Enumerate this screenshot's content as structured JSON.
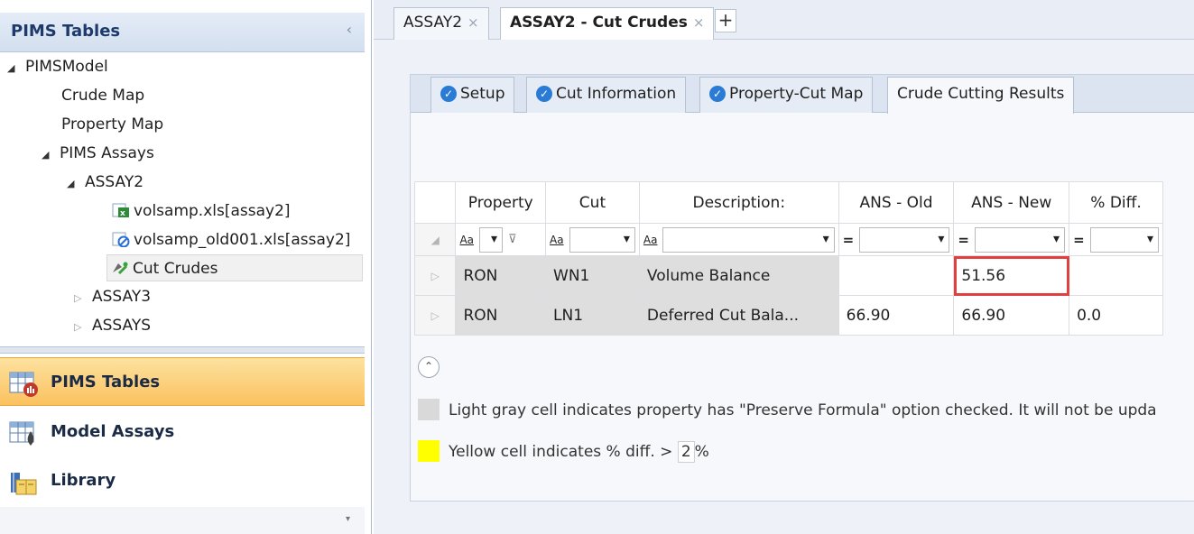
{
  "sidebar": {
    "title": "PIMS Tables",
    "collapse_glyph": "‹",
    "tree": {
      "root": "PIMSModel",
      "crude_map": "Crude Map",
      "property_map": "Property Map",
      "pims_assays": "PIMS Assays",
      "assay2": "ASSAY2",
      "file1": "volsamp.xls[assay2]",
      "file2": "volsamp_old001.xls[assay2]",
      "cut_crudes": "Cut Crudes",
      "assay3": "ASSAY3",
      "assays": "ASSAYS"
    },
    "nav": {
      "pims_tables": "PIMS Tables",
      "model_assays": "Model Assays",
      "library": "Library"
    }
  },
  "doc_tabs": {
    "tab1": "ASSAY2",
    "tab2": "ASSAY2 - Cut Crudes",
    "close_glyph": "×",
    "add_glyph": "+"
  },
  "subtabs": {
    "setup": "Setup",
    "cut_information": "Cut Information",
    "property_cut_map": "Property-Cut Map",
    "crude_cutting_results": "Crude Cutting Results",
    "check_glyph": "✓"
  },
  "grid": {
    "headers": [
      "Property",
      "Cut",
      "Description:",
      "ANS - Old",
      "ANS - New",
      "% Diff."
    ],
    "filter": {
      "aa": "Aa",
      "eq": "="
    },
    "rows": [
      {
        "property": "RON",
        "cut": "WN1",
        "description": "Volume Balance",
        "old": "",
        "new": "51.56",
        "diff": ""
      },
      {
        "property": "RON",
        "cut": "LN1",
        "description": "Deferred Cut Bala...",
        "old": "66.90",
        "new": "66.90",
        "diff": "0.0"
      }
    ],
    "row_marker": "▷"
  },
  "legend": {
    "gray_text": "Light gray cell indicates property has \"Preserve Formula\" option checked. It will not be upda",
    "yellow_prefix": "Yellow cell indicates % diff. >",
    "yellow_value": "2",
    "yellow_suffix": "%",
    "gray_color": "#d9d9d9",
    "yellow_color": "#ffff00"
  },
  "colors": {
    "accent": "#2a7bd6",
    "active_nav": "#fbc15e",
    "highlight": "#e04040"
  }
}
